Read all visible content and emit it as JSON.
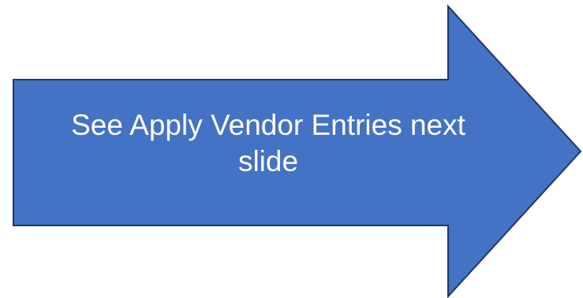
{
  "shape": {
    "type": "right-arrow",
    "fill_color": "#4472C4",
    "stroke_color": "#1F3864"
  },
  "arrow_text": {
    "line1": "See Apply Vendor Entries next",
    "line2": "slide"
  }
}
